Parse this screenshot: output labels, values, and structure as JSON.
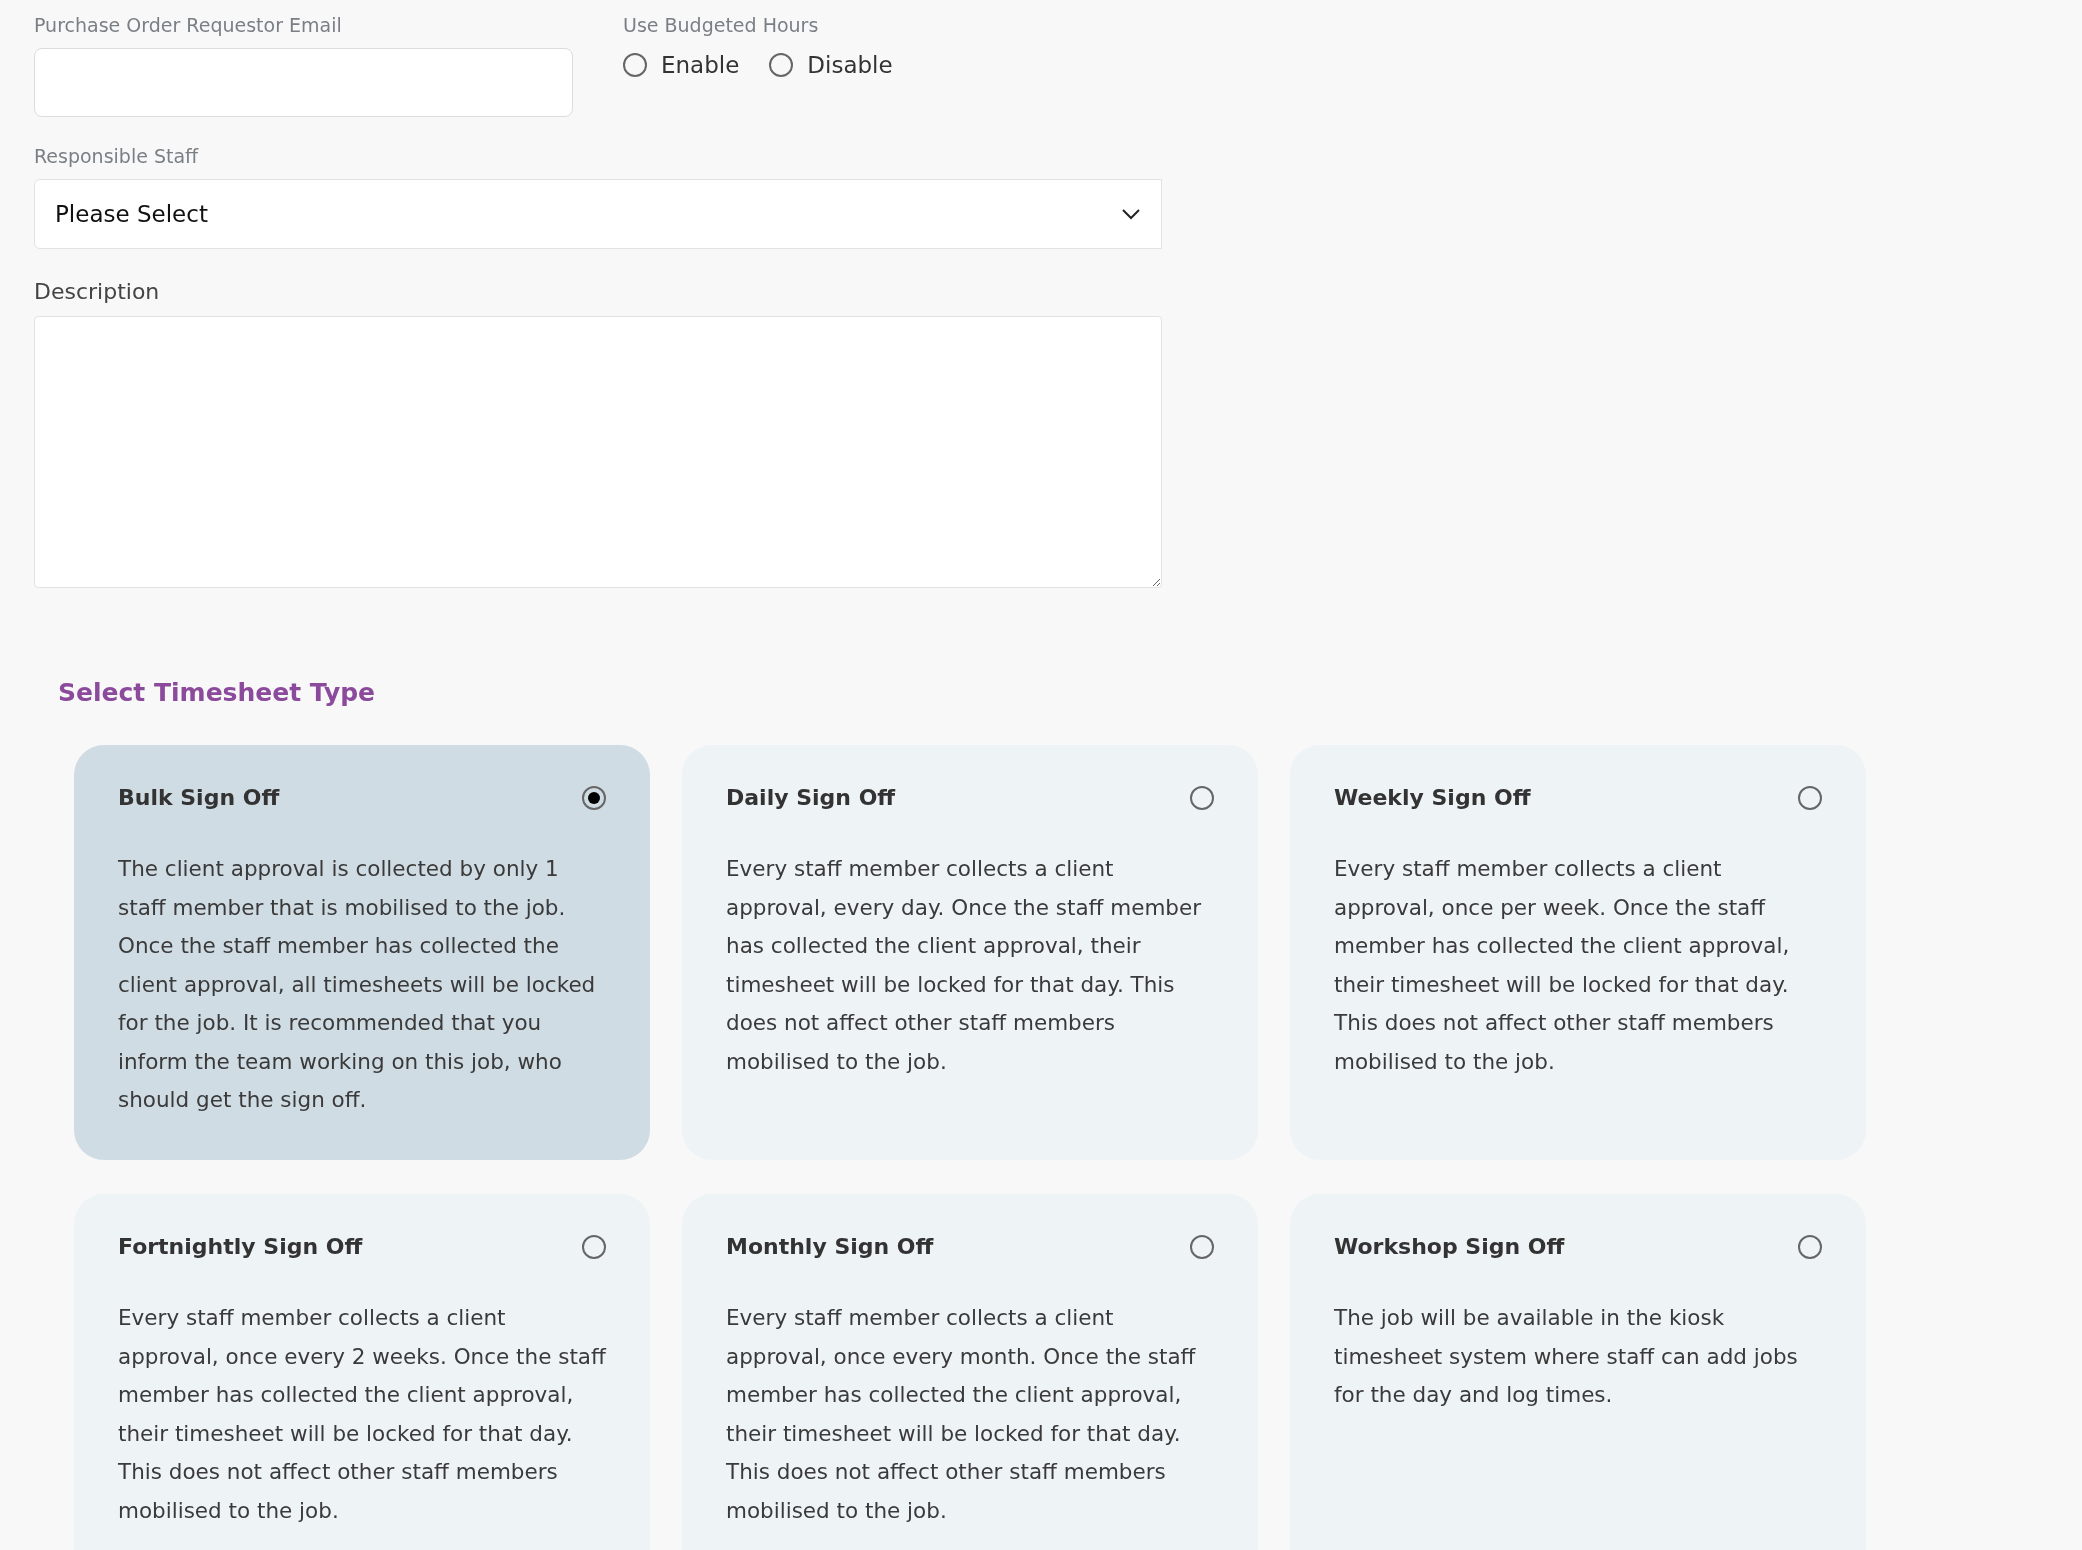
{
  "email_field": {
    "label": "Purchase Order Requestor Email"
  },
  "budgeted_hours": {
    "label": "Use Budgeted Hours",
    "options": [
      {
        "label": "Enable",
        "selected": false
      },
      {
        "label": "Disable",
        "selected": false
      }
    ]
  },
  "responsible_staff": {
    "label": "Responsible Staff",
    "value": "Please Select"
  },
  "description": {
    "label": "Description"
  },
  "timesheet_type": {
    "title": "Select Timesheet Type",
    "options": [
      {
        "title": "Bulk Sign Off",
        "selected": true,
        "text": "The client approval is collected by only 1 staff member that is mobilised to the job. Once the staff member has collected the client approval, all timesheets will be locked for the job. It is recommended that you inform the team working on this job, who should get the sign off."
      },
      {
        "title": "Daily Sign Off",
        "selected": false,
        "text": "Every staff member collects a client approval, every day. Once the staff member has collected the client approval, their timesheet will be locked for that day. This does not affect other staff members mobilised to the job."
      },
      {
        "title": "Weekly Sign Off",
        "selected": false,
        "text": "Every staff member collects a client approval, once per week. Once the staff member has collected the client approval, their timesheet will be locked for that day. This does not affect other staff members mobilised to the job."
      },
      {
        "title": "Fortnightly Sign Off",
        "selected": false,
        "text": "Every staff member collects a client approval, once every 2 weeks. Once the staff member has collected the client approval, their timesheet will be locked for that day. This does not affect other staff members mobilised to the job."
      },
      {
        "title": "Monthly Sign Off",
        "selected": false,
        "text": "Every staff member collects a client approval, once every month. Once the staff member has collected the client approval, their timesheet will be locked for that day. This does not affect other staff members mobilised to the job."
      },
      {
        "title": "Workshop Sign Off",
        "selected": false,
        "text": "The job will be available in the kiosk timesheet system where staff can add jobs for the day and log times."
      }
    ]
  }
}
